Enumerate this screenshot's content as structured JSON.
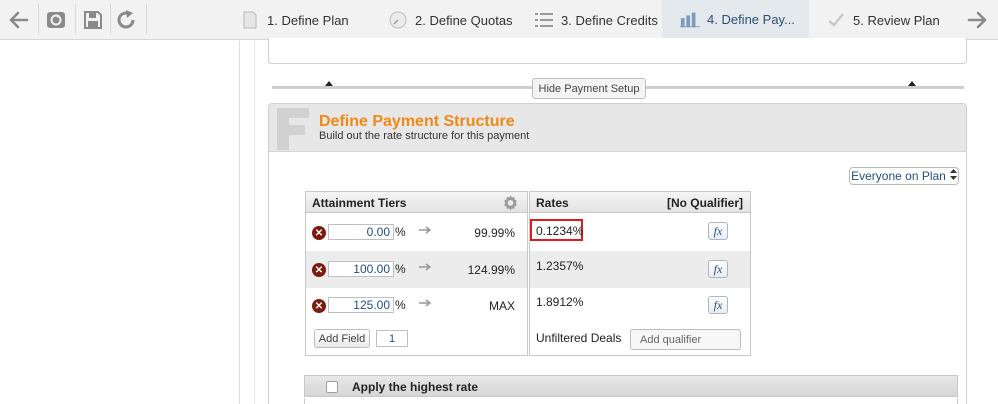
{
  "toolbar": {
    "back_icon": "arrow-left-icon",
    "refresh_icon": "refresh-icon",
    "save_icon": "floppy-icon",
    "redo_icon": "redo-icon",
    "forward_icon": "arrow-right-icon"
  },
  "steps": [
    {
      "label": "1. Define Plan",
      "icon": "document-icon"
    },
    {
      "label": "2. Define Quotas",
      "icon": "gauge-icon"
    },
    {
      "label": "3. Define Credits",
      "icon": "list-icon"
    },
    {
      "label": "4. Define Pay...",
      "icon": "bar-chart-icon",
      "active": true
    },
    {
      "label": "5. Review Plan",
      "icon": "checkmark-icon"
    }
  ],
  "divider": {
    "hide_label": "Hide Payment Setup"
  },
  "panel": {
    "title": "Define Payment Structure",
    "subtitle": "Build out the rate structure for this payment"
  },
  "plan_select": {
    "value": "Everyone on Plan"
  },
  "tiers": {
    "header": "Attainment Tiers",
    "rows": [
      {
        "from": "0.00",
        "pct": "%",
        "to": "99.99%"
      },
      {
        "from": "100.00",
        "pct": "%",
        "to": "124.99%"
      },
      {
        "from": "125.00",
        "pct": "%",
        "to": "MAX"
      }
    ],
    "add_field_label": "Add Field",
    "add_count": "1"
  },
  "rates": {
    "header": "Rates",
    "qualifier": "[No Qualifier]",
    "rows": [
      {
        "value": "0.1234%"
      },
      {
        "value": "1.2357%"
      },
      {
        "value": "1.8912%"
      }
    ],
    "fx_label": "fx",
    "unfiltered_label": "Unfiltered Deals",
    "add_qualifier_label": "Add qualifier"
  },
  "highest_rate": {
    "label": "Apply the highest rate",
    "checked": false
  },
  "colors": {
    "accent_title": "#ef8a17",
    "highlight_border": "#e11b1b",
    "delete_icon": "#7d1a10",
    "active_step": "#2d4f74"
  }
}
